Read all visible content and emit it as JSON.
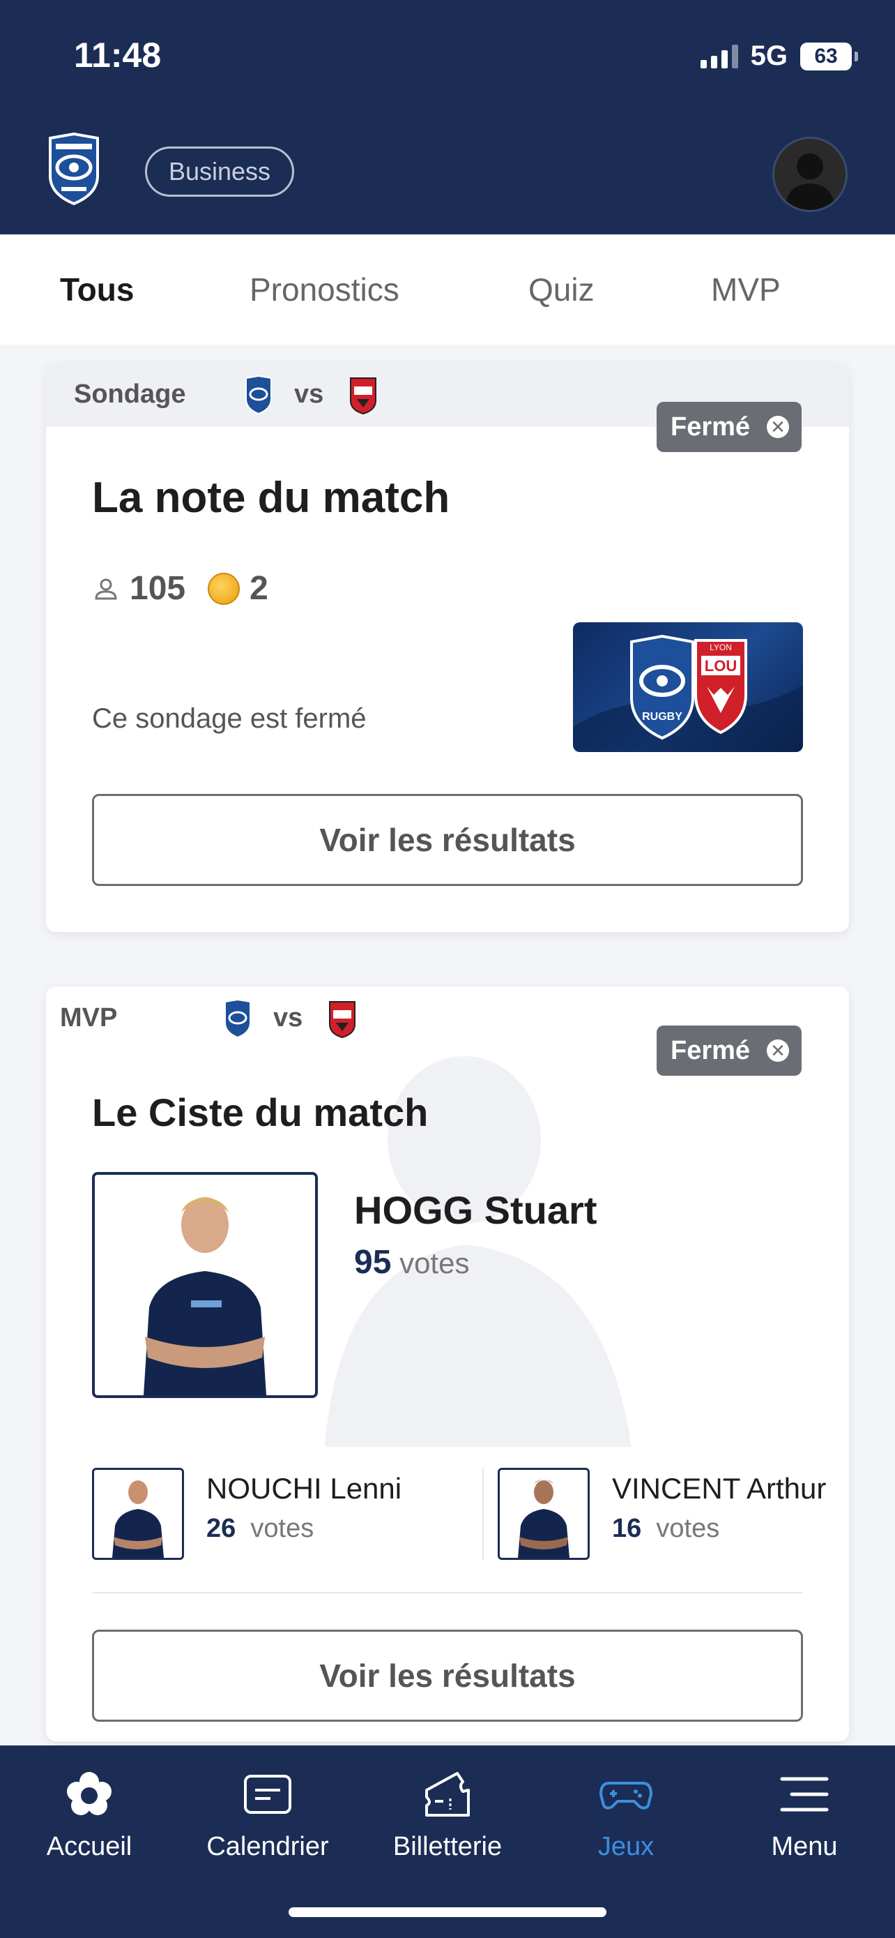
{
  "status_bar": {
    "time": "11:48",
    "network": "5G",
    "battery": "63"
  },
  "header": {
    "business_label": "Business"
  },
  "tabs": [
    {
      "label": "Tous",
      "active": true
    },
    {
      "label": "Pronostics",
      "active": false
    },
    {
      "label": "Quiz",
      "active": false
    },
    {
      "label": "MVP",
      "active": false
    }
  ],
  "poll_card": {
    "type_label": "Sondage",
    "vs_label": "vs",
    "status_label": "Fermé",
    "title": "La note du match",
    "participants": "105",
    "coins": "2",
    "closed_text": "Ce sondage est fermé",
    "match_image_text": {
      "home": "RUGBY",
      "away": "LOU",
      "away_city": "LYON"
    },
    "results_button": "Voir les résultats"
  },
  "mvp_card": {
    "type_label": "MVP",
    "vs_label": "vs",
    "status_label": "Fermé",
    "title": "Le Ciste du match",
    "winner": {
      "name": "HOGG Stuart",
      "votes": "95",
      "votes_label": "votes"
    },
    "runners_up": [
      {
        "name": "NOUCHI Lenni",
        "votes": "26",
        "votes_label": "votes"
      },
      {
        "name": "VINCENT Arthur",
        "votes": "16",
        "votes_label": "votes"
      }
    ],
    "results_button": "Voir les résultats"
  },
  "bottom_nav": [
    {
      "label": "Accueil",
      "icon": "flower-icon",
      "active": false
    },
    {
      "label": "Calendrier",
      "icon": "calendar-icon",
      "active": false
    },
    {
      "label": "Billetterie",
      "icon": "ticket-icon",
      "active": false
    },
    {
      "label": "Jeux",
      "icon": "gamepad-icon",
      "active": true
    },
    {
      "label": "Menu",
      "icon": "menu-icon",
      "active": false
    }
  ],
  "colors": {
    "navy": "#1b2d55",
    "active_nav": "#3b8fe0",
    "closed_badge": "#6a6d73"
  }
}
